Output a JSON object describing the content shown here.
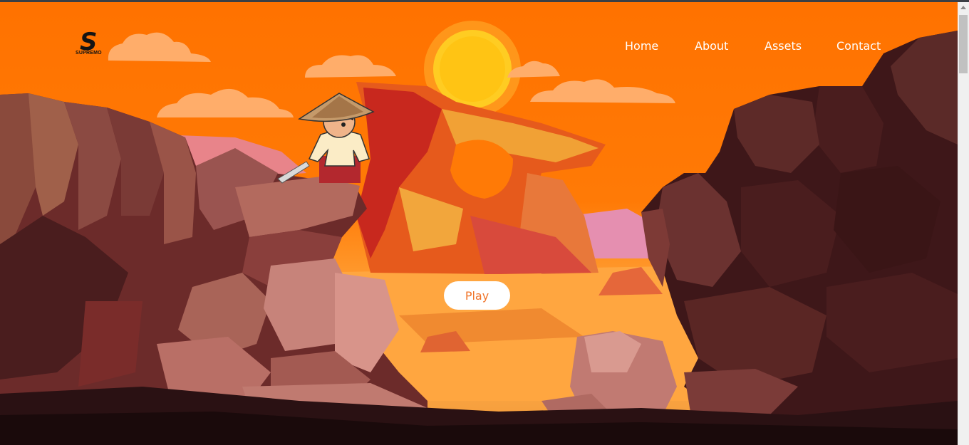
{
  "logo": {
    "letter": "S",
    "text": "SUPREMO"
  },
  "nav": {
    "items": [
      "Home",
      "About",
      "Assets",
      "Contact"
    ]
  },
  "hero": {
    "play_label": "Play"
  },
  "colors": {
    "sky": "#ff7200",
    "sun": "#ffc414",
    "play_text": "#f07328",
    "rock_dark": "#2a1113"
  }
}
